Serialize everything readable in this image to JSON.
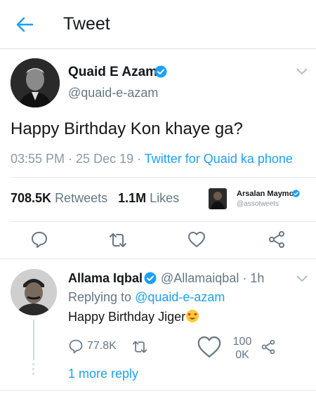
{
  "header": {
    "title": "Tweet"
  },
  "tweet": {
    "author_name": "Quaid E Azam",
    "author_handle": "@quaid-e-azam",
    "text": "Happy Birthday Kon khaye ga?",
    "time": "03:55 PM",
    "sep1": " · ",
    "date": "25 Dec 19",
    "sep2": " · ",
    "source": "Twitter for Quaid ka phone",
    "retweets_count": "708.5K",
    "retweets_label": "Retweets",
    "likes_count": "1.1M",
    "likes_label": "Likes"
  },
  "watermark": {
    "name": "Arsalan Maymon",
    "handle": "@assotweets"
  },
  "actions": {
    "icons": [
      "reply-icon",
      "retweet-icon",
      "like-icon",
      "share-icon"
    ]
  },
  "reply": {
    "author_name": "Allama Iqbal",
    "author_handle": "@Allamaiqbal · 1h",
    "replying_prefix": "Replying to ",
    "replying_to": "@quaid-e-azam",
    "text": "Happy Birthday Jiger",
    "reply_count": "77.8K",
    "like_count_line1": "100",
    "like_count_line2": "0K",
    "more_replies": "1 more reply"
  },
  "colors": {
    "accent": "#1da1f2",
    "secondary_text": "#657786",
    "primary_text": "#14171a"
  }
}
